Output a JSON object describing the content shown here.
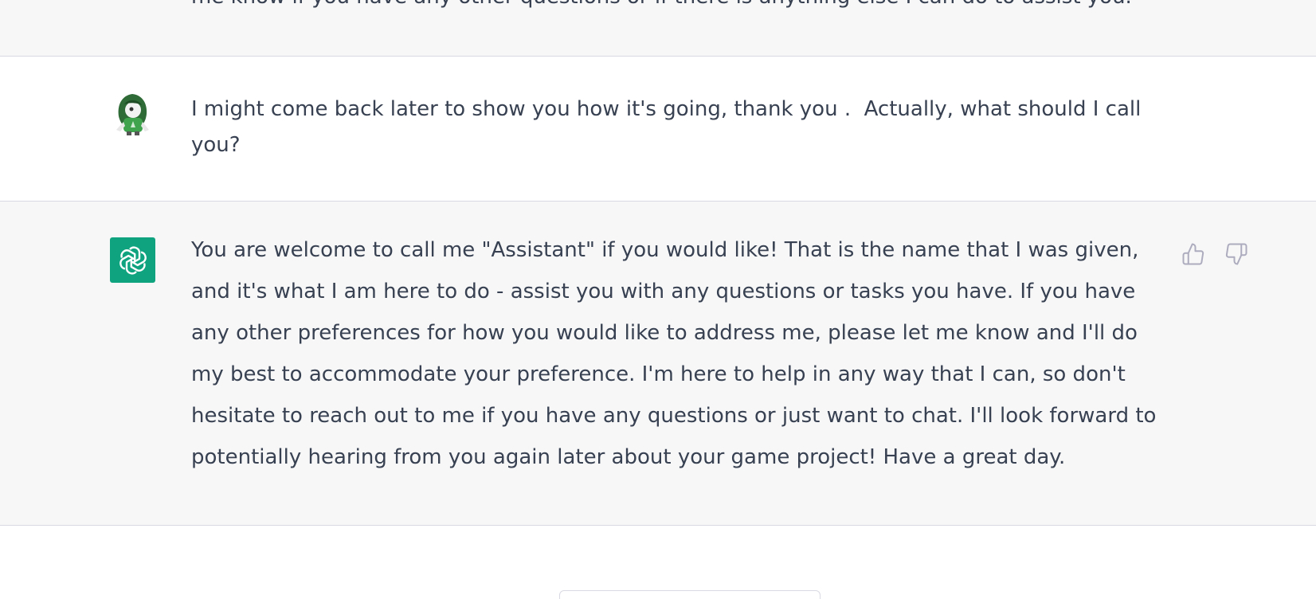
{
  "thread": {
    "previous_message": {
      "role": "assistant",
      "text_fragment": "me know if you have any other questions or if there is anything else I can do to assist you."
    },
    "user_message": {
      "role": "user",
      "text": "I might come back later to show you how it's going, thank you .  Actually, what should I call you?",
      "avatar_icon": "green-hooded-character-avatar-icon"
    },
    "assistant_message": {
      "role": "assistant",
      "text": "You are welcome to call me \"Assistant\" if you would like! That is the name that I was given, and it's what I am here to do - assist you with any questions or tasks you have. If you have any other preferences for how you would like to address me, please let me know and I'll do my best to accommodate your preference. I'm here to help in any way that I can, so don't hesitate to reach out to me if you have any questions or just want to chat. I'll look forward to potentially hearing from you again later about your game project! Have a great day.",
      "avatar_icon": "openai-logo-icon",
      "feedback": {
        "thumbs_up_icon": "thumbs-up-icon",
        "thumbs_down_icon": "thumbs-down-icon"
      }
    }
  },
  "colors": {
    "assistant_bg": "#f7f7f8",
    "user_bg": "#ffffff",
    "divider": "#d9d9e3",
    "brand_green": "#10a37f",
    "text": "#374151",
    "icon_gray": "#acacbe"
  }
}
